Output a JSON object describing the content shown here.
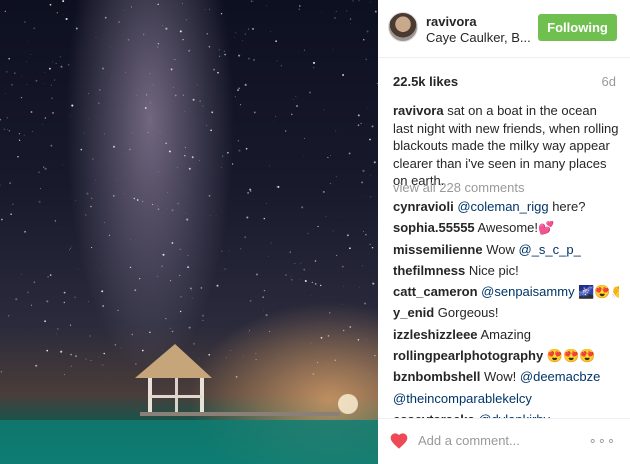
{
  "post": {
    "photo_icon": "milky-way-photo",
    "username": "ravivora",
    "location": "Caye Caulker, B...",
    "follow_label": "Following",
    "likes": "22.5k likes",
    "age": "6d",
    "caption_user": "ravivora",
    "caption_text": " sat on a boat in the ocean last night with new friends, when rolling blackouts made the milky way appear clearer than i've seen in many places on earth.",
    "view_all": "view all 228 comments",
    "add_comment_placeholder": "Add a comment...",
    "more_label": "∘∘∘"
  },
  "comments": [
    {
      "user": "cynravioli",
      "text": " ",
      "mention": "@coleman_rigg",
      "after": " here?"
    },
    {
      "user": "sophia.55555",
      "text": " Awesome!",
      "mention": "",
      "after": "💕"
    },
    {
      "user": "missemilienne",
      "text": " Wow ",
      "mention": "@_s_c_p_",
      "after": ""
    },
    {
      "user": "thefilmness",
      "text": " Nice pic!",
      "mention": "",
      "after": ""
    },
    {
      "user": "catt_cameron",
      "text": " ",
      "mention": "@senpaisammy",
      "after": " 🌌😍👏"
    },
    {
      "user": "y_enid",
      "text": " Gorgeous!",
      "mention": "",
      "after": ""
    },
    {
      "user": "izzleshizzleee",
      "text": " Amazing",
      "mention": "",
      "after": ""
    },
    {
      "user": "rollingpearlphotography",
      "text": " ",
      "mention": "",
      "after": "😍😍😍"
    },
    {
      "user": "bznbombshell",
      "text": " Wow! ",
      "mention": "@deemacbze",
      "after": ""
    },
    {
      "user": "",
      "text": "",
      "mention": "@theincomparablekelcy",
      "after": ""
    },
    {
      "user": "caseytaracka",
      "text": " ",
      "mention": "@dylankirby",
      "after": ""
    }
  ],
  "colors": {
    "follow_button": "#70c050",
    "heart": "#ed4956",
    "mention": "#003569"
  }
}
